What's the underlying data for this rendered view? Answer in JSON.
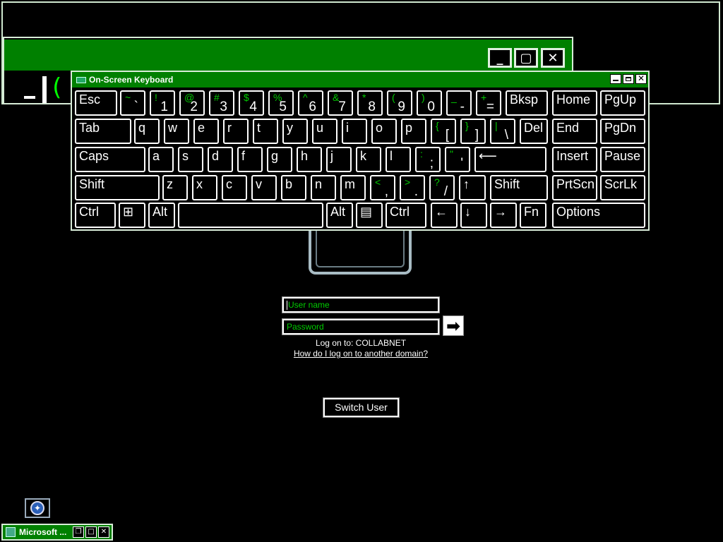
{
  "osk": {
    "title": "On-Screen Keyboard",
    "rows": [
      [
        {
          "label": "Esc"
        },
        {
          "shift": "~",
          "base": "`"
        },
        {
          "shift": "!",
          "base": "1"
        },
        {
          "shift": "@",
          "base": "2"
        },
        {
          "shift": "#",
          "base": "3"
        },
        {
          "shift": "$",
          "base": "4"
        },
        {
          "shift": "%",
          "base": "5"
        },
        {
          "shift": "^",
          "base": "6"
        },
        {
          "shift": "&",
          "base": "7"
        },
        {
          "shift": "*",
          "base": "8"
        },
        {
          "shift": "(",
          "base": "9"
        },
        {
          "shift": ")",
          "base": "0"
        },
        {
          "shift": "_",
          "base": "-"
        },
        {
          "shift": "+",
          "base": "="
        },
        {
          "label": "Bksp"
        },
        {
          "label": "Home"
        },
        {
          "label": "PgUp"
        }
      ],
      [
        {
          "label": "Tab"
        },
        {
          "label": "q"
        },
        {
          "label": "w"
        },
        {
          "label": "e"
        },
        {
          "label": "r"
        },
        {
          "label": "t"
        },
        {
          "label": "y"
        },
        {
          "label": "u"
        },
        {
          "label": "i"
        },
        {
          "label": "o"
        },
        {
          "label": "p"
        },
        {
          "shift": "{",
          "base": "["
        },
        {
          "shift": "}",
          "base": "]"
        },
        {
          "shift": "|",
          "base": "\\"
        },
        {
          "label": "Del"
        },
        {
          "label": "End"
        },
        {
          "label": "PgDn"
        }
      ],
      [
        {
          "label": "Caps"
        },
        {
          "label": "a"
        },
        {
          "label": "s"
        },
        {
          "label": "d"
        },
        {
          "label": "f"
        },
        {
          "label": "g"
        },
        {
          "label": "h"
        },
        {
          "label": "j"
        },
        {
          "label": "k"
        },
        {
          "label": "l"
        },
        {
          "shift": ":",
          "base": ";"
        },
        {
          "shift": "\"",
          "base": "'"
        },
        {
          "label": "⟵"
        },
        {
          "label": "Insert"
        },
        {
          "label": "Pause"
        }
      ],
      [
        {
          "label": "Shift"
        },
        {
          "label": "z"
        },
        {
          "label": "x"
        },
        {
          "label": "c"
        },
        {
          "label": "v"
        },
        {
          "label": "b"
        },
        {
          "label": "n"
        },
        {
          "label": "m"
        },
        {
          "shift": "<",
          "base": ","
        },
        {
          "shift": ">",
          "base": "."
        },
        {
          "shift": "?",
          "base": "/"
        },
        {
          "label": "↑"
        },
        {
          "label": "Shift"
        },
        {
          "label": "PrtScn"
        },
        {
          "label": "ScrLk"
        }
      ],
      [
        {
          "label": "Ctrl"
        },
        {
          "label": "⊞",
          "icon": "windows-icon"
        },
        {
          "label": "Alt"
        },
        {
          "label": ""
        },
        {
          "label": "Alt"
        },
        {
          "label": "▤",
          "icon": "menu-icon"
        },
        {
          "label": "Ctrl"
        },
        {
          "label": "←"
        },
        {
          "label": "↓"
        },
        {
          "label": "→"
        },
        {
          "label": "Fn"
        },
        {
          "label": "Options"
        }
      ]
    ]
  },
  "logon": {
    "username_placeholder": "User name",
    "password_placeholder": "Password",
    "log_on_to": "Log on to: COLLABNET",
    "domain_link": "How do I log on to another domain?",
    "go_arrow": "➡",
    "switch_user": "Switch User"
  },
  "taskbar": {
    "item_label": "Microsoft ..."
  },
  "colors": {
    "titlebar": "#008000",
    "shift_glyph": "#00cc00",
    "background": "#000000"
  }
}
